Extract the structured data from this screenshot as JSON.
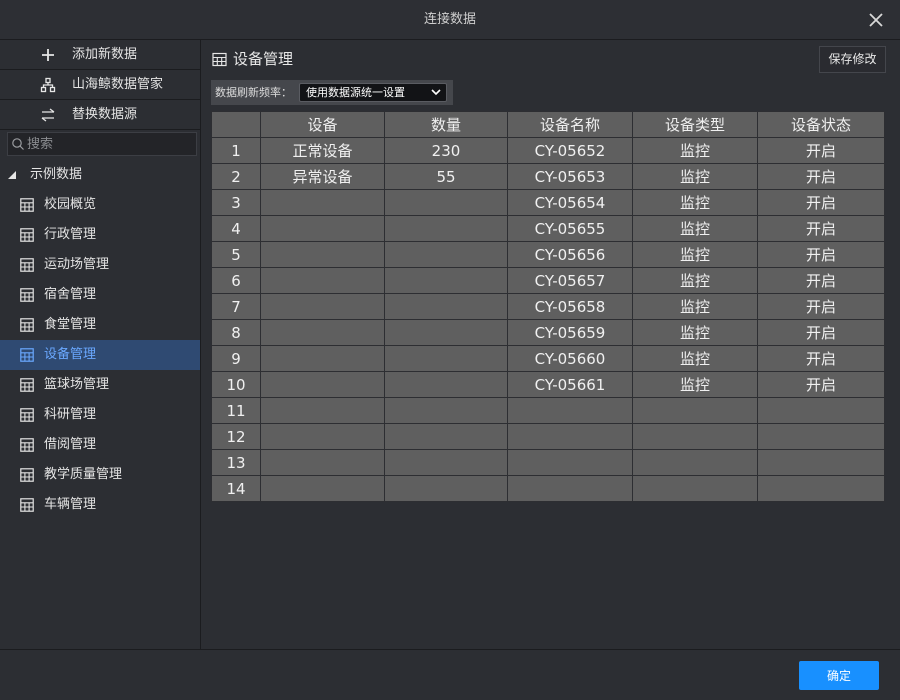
{
  "window": {
    "title": "连接数据",
    "close_icon": "close-icon"
  },
  "sidebar": {
    "actions": [
      {
        "label": "添加新数据",
        "icon": "plus-icon"
      },
      {
        "label": "山海鲸数据管家",
        "icon": "hierarchy-icon"
      },
      {
        "label": "替换数据源",
        "icon": "swap-icon"
      }
    ],
    "search": {
      "placeholder": "搜索",
      "value": ""
    },
    "tree": {
      "root_label": "示例数据",
      "items": [
        {
          "label": "校园概览"
        },
        {
          "label": "行政管理"
        },
        {
          "label": "运动场管理"
        },
        {
          "label": "宿舍管理"
        },
        {
          "label": "食堂管理"
        },
        {
          "label": "设备管理",
          "active": true
        },
        {
          "label": "篮球场管理"
        },
        {
          "label": "科研管理"
        },
        {
          "label": "借阅管理"
        },
        {
          "label": "教学质量管理"
        },
        {
          "label": "车辆管理"
        }
      ]
    }
  },
  "main": {
    "title": "设备管理",
    "save_label": "保存修改",
    "refresh": {
      "label": "数据刷新频率：",
      "selected": "使用数据源统一设置"
    },
    "table": {
      "columns": [
        "",
        "设备",
        "数量",
        "设备名称",
        "设备类型",
        "设备状态"
      ],
      "rows": [
        [
          "1",
          "正常设备",
          "230",
          "CY-05652",
          "监控",
          "开启"
        ],
        [
          "2",
          "异常设备",
          "55",
          "CY-05653",
          "监控",
          "开启"
        ],
        [
          "3",
          "",
          "",
          "CY-05654",
          "监控",
          "开启"
        ],
        [
          "4",
          "",
          "",
          "CY-05655",
          "监控",
          "开启"
        ],
        [
          "5",
          "",
          "",
          "CY-05656",
          "监控",
          "开启"
        ],
        [
          "6",
          "",
          "",
          "CY-05657",
          "监控",
          "开启"
        ],
        [
          "7",
          "",
          "",
          "CY-05658",
          "监控",
          "开启"
        ],
        [
          "8",
          "",
          "",
          "CY-05659",
          "监控",
          "开启"
        ],
        [
          "9",
          "",
          "",
          "CY-05660",
          "监控",
          "开启"
        ],
        [
          "10",
          "",
          "",
          "CY-05661",
          "监控",
          "开启"
        ],
        [
          "11",
          "",
          "",
          "",
          "",
          ""
        ],
        [
          "12",
          "",
          "",
          "",
          "",
          ""
        ],
        [
          "13",
          "",
          "",
          "",
          "",
          ""
        ],
        [
          "14",
          "",
          "",
          "",
          "",
          ""
        ]
      ]
    }
  },
  "footer": {
    "ok_label": "确定"
  },
  "colors": {
    "accent": "#1890ff",
    "active_item_bg": "#2f4a72",
    "active_item_text": "#6aa8ff",
    "cell_bg": "#5f5f5f"
  }
}
